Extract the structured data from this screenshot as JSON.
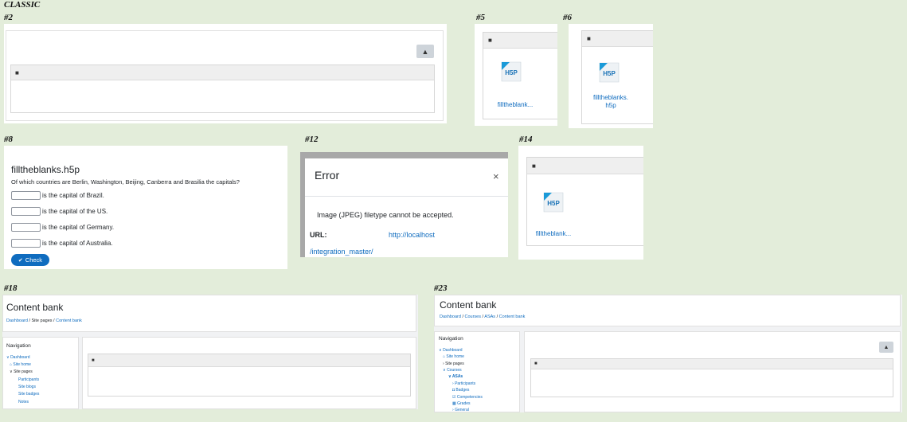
{
  "page_label": "CLASSIC",
  "panels": {
    "p2": {
      "label": "#2"
    },
    "p5": {
      "label": "#5",
      "file_name": "filltheblank..."
    },
    "p6": {
      "label": "#6",
      "file_name_line1": "filltheblanks.",
      "file_name_line2": "h5p"
    },
    "p8": {
      "label": "#8",
      "title": "filltheblanks.h5p",
      "question": "Of which countries are Berlin, Washington, Beijing, Canberra and Brasilia the capitals?",
      "rows": [
        "is the capital of Brazil.",
        "is the capital of the US.",
        "is the capital of Germany.",
        "is the capital of Australia."
      ],
      "check_label": "Check"
    },
    "p12": {
      "label": "#12",
      "title": "Error",
      "close_glyph": "×",
      "message": "Image (JPEG) filetype cannot be accepted.",
      "url_label": "URL:",
      "url_part1": "http://localhost",
      "url_part2": "/integration_master/"
    },
    "p14": {
      "label": "#14",
      "file_name": "filltheblank..."
    },
    "p18": {
      "label": "#18",
      "title": "Content bank",
      "breadcrumb": [
        "Dashboard",
        "Site pages",
        "Content bank"
      ],
      "nav_title": "Navigation",
      "nav": [
        "Dashboard",
        "Site home",
        "Site pages",
        "Participants",
        "Site blogs",
        "Site badges",
        "Notes"
      ]
    },
    "p23": {
      "label": "#23",
      "title": "Content bank",
      "breadcrumb": [
        "Dashboard",
        "Courses",
        "ASAs",
        "Content bank"
      ],
      "nav_title": "Navigation",
      "nav": [
        "Dashboard",
        "Site home",
        "Site pages",
        "Courses",
        "ASAs",
        "Participants",
        "Badges",
        "Competencies",
        "Grades",
        "General"
      ]
    }
  },
  "h5p_logo_text": "H5P",
  "colors": {
    "background": "#e3edda",
    "link": "#0f6cbf",
    "check_button": "#0f6cbf"
  }
}
